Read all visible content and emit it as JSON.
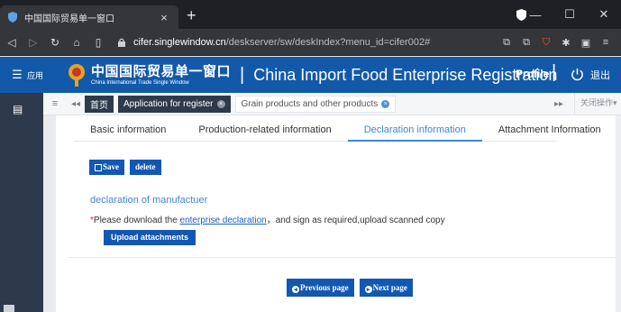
{
  "browser": {
    "tab_title": "中国国际贸易单一窗口",
    "tab_close": "×",
    "new_tab": "+",
    "url_host": "cifer.singlewindow.cn",
    "url_path": "/deskserver/sw/deskIndex?menu_id=cifer002#",
    "window_controls": {
      "minimize": "—",
      "maximize": "☐",
      "close": "✕"
    }
  },
  "header": {
    "apps_label": "应用",
    "brand_cn": "中国国际贸易单一窗口",
    "brand_en": "China International Trade Single Window",
    "separator": "|",
    "title": "China Import Food Enterprise Registration",
    "profile": "Profile",
    "logout": "退出"
  },
  "page_tabs": {
    "home": "首页",
    "items": [
      {
        "label": "Application for register",
        "style": "dark"
      },
      {
        "label": "Grain products and other products",
        "style": "light"
      }
    ],
    "close_ops": "关闭操作"
  },
  "form_tabs": [
    {
      "label": "Basic information",
      "active": false
    },
    {
      "label": "Production-related information",
      "active": false
    },
    {
      "label": "Declaration information",
      "active": true
    },
    {
      "label": "Attachment Information",
      "active": false
    }
  ],
  "actions": {
    "save": "Save",
    "delete": "delete"
  },
  "declaration": {
    "title": "declaration of manufactuer",
    "notice_star": "*",
    "notice_before": "Please download the ",
    "notice_link": "enterprise declaration",
    "notice_after": "，and sign as required,upload scanned copy",
    "upload": "Upload attachments"
  },
  "pager": {
    "previous": "Previous page",
    "next": "Next page"
  },
  "colors": {
    "header_blue": "#1259a9",
    "button_blue": "#1257b3",
    "link_blue": "#3f86d8",
    "sidebar": "#2d3a4b"
  }
}
